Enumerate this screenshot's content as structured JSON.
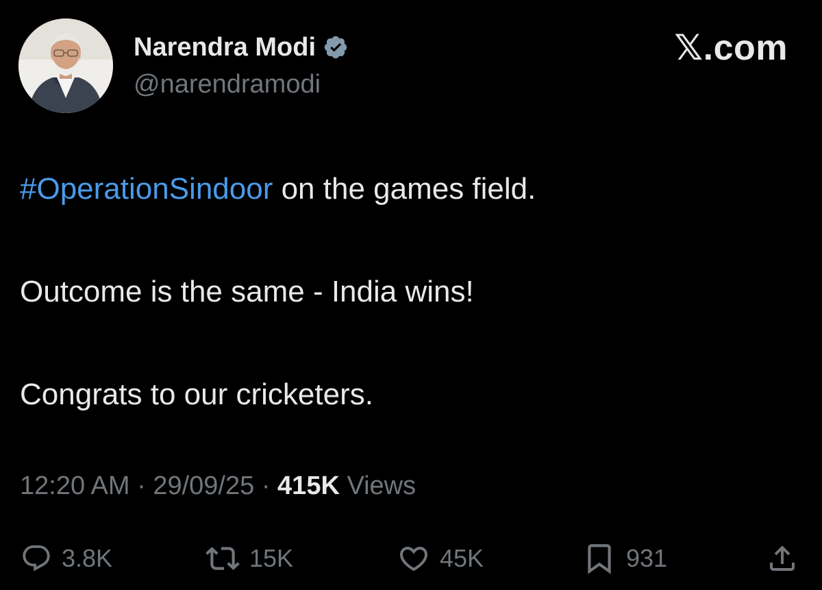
{
  "author": {
    "display_name": "Narendra Modi",
    "handle": "@narendramodi",
    "verified": true
  },
  "brand": "𝕏.com",
  "tweet": {
    "hashtag": "#OperationSindoor",
    "line1_rest": " on the games field.",
    "line2": "Outcome is the same - India wins!",
    "line3": "Congrats to our cricketers."
  },
  "meta": {
    "time": "12:20 AM",
    "separator": " · ",
    "date": "29/09/25",
    "views_count": "415K",
    "views_label": " Views"
  },
  "actions": {
    "replies": "3.8K",
    "reposts": "15K",
    "likes": "45K",
    "bookmarks": "931"
  },
  "colors": {
    "background": "#000000",
    "text": "#e7e9ea",
    "secondary": "#71767b",
    "hashtag": "#4a9bea"
  }
}
